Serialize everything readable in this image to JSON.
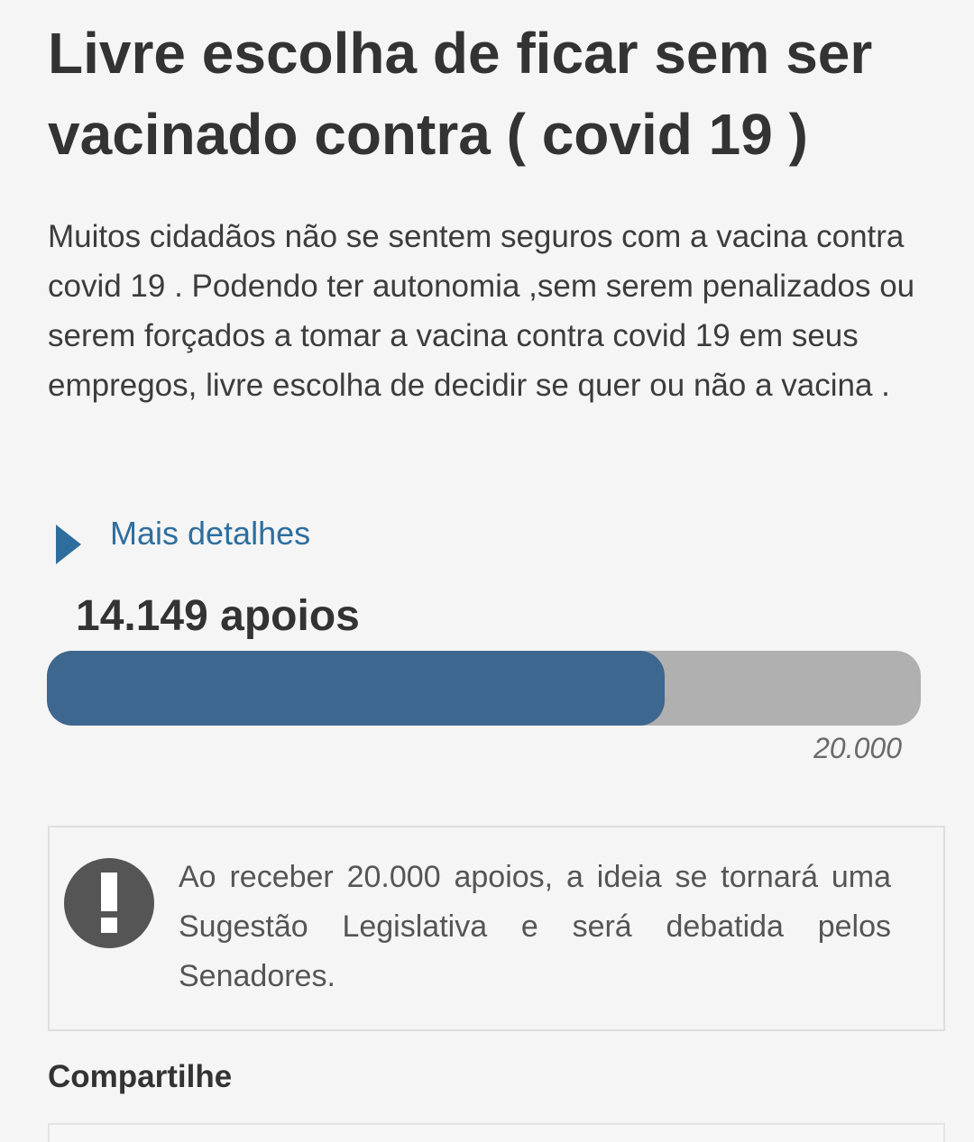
{
  "idea": {
    "title": "Livre escolha de ficar sem ser vacinado contra ( covid 19 )",
    "description": "Muitos cidadãos não se sentem seguros com a vacina contra covid 19 . Podendo ter autonomia ,sem serem penalizados ou serem forçados a tomar a vacina contra covid 19 em seus empregos, livre escolha de decidir se quer ou não a vacina ."
  },
  "details": {
    "label": "Mais detalhes",
    "icon": "triangle-right-icon"
  },
  "support": {
    "count_label": "14.149 apoios",
    "count": 14149,
    "goal": 20000,
    "goal_label": "20.000",
    "progress_fraction": 0.707,
    "fill_color": "#3e678f",
    "track_color": "#b0b0b0"
  },
  "notice": {
    "icon": "exclamation-circle-icon",
    "text": "Ao receber 20.000 apoios, a ideia se tornará uma Sugestão Legislativa e será debatida pelos Senadores."
  },
  "share": {
    "heading": "Compartilhe"
  },
  "colors": {
    "link": "#2e6e9e",
    "background": "#f5f5f5"
  }
}
